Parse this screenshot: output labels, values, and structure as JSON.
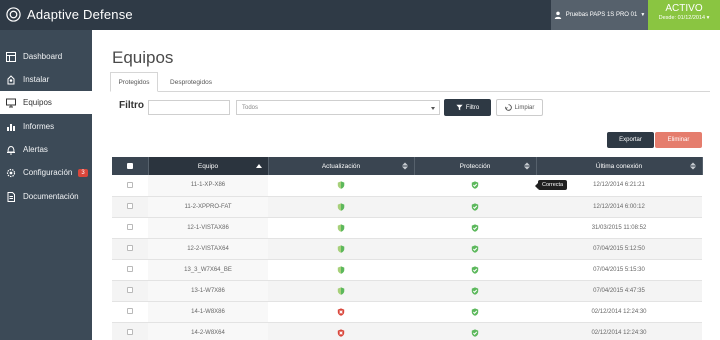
{
  "app": {
    "title": "Adaptive Defense"
  },
  "user": {
    "name": "Pruebas PAPS 1S PRO 01",
    "menu_icon": "user-icon"
  },
  "status": {
    "label": "ACTIVO",
    "since": "Desde: 01/12/2014"
  },
  "sidebar": {
    "items": [
      {
        "label": "Dashboard",
        "icon": "dashboard-icon"
      },
      {
        "label": "Instalar",
        "icon": "install-icon"
      },
      {
        "label": "Equipos",
        "icon": "monitor-icon",
        "active": true
      },
      {
        "label": "Informes",
        "icon": "reports-icon"
      },
      {
        "label": "Alertas",
        "icon": "bell-icon"
      },
      {
        "label": "Configuración",
        "icon": "gear-icon",
        "badge": "3"
      },
      {
        "label": "Documentación",
        "icon": "document-icon"
      }
    ]
  },
  "page": {
    "title": "Equipos"
  },
  "tabs": [
    {
      "label": "Protegidos",
      "active": true
    },
    {
      "label": "Desprotegidos"
    }
  ],
  "filter": {
    "label": "Filtro",
    "text_value": "",
    "select_value": "Todos",
    "filter_button": "Filtro",
    "clear_button": "Limpiar"
  },
  "actions": {
    "export": "Exportar",
    "delete": "Eliminar"
  },
  "table": {
    "headers": {
      "equipo": "Equipo",
      "actualizacion": "Actualización",
      "proteccion": "Protección",
      "ultima": "Última conexión"
    },
    "rows": [
      {
        "name": "11-1-XP-X86",
        "update": "ok",
        "protection": "ok",
        "last": "12/12/2014 6:21:21"
      },
      {
        "name": "11-2-XPPRO-FAT",
        "update": "ok",
        "protection": "ok",
        "last": "12/12/2014 6:00:12"
      },
      {
        "name": "12-1-VISTAX86",
        "update": "ok",
        "protection": "ok",
        "last": "31/03/2015 11:08:52"
      },
      {
        "name": "12-2-VISTAX64",
        "update": "ok",
        "protection": "ok",
        "last": "07/04/2015 5:12:50"
      },
      {
        "name": "13_3_W7X64_BE",
        "update": "ok",
        "protection": "ok",
        "last": "07/04/2015 5:15:30"
      },
      {
        "name": "13-1-W7X86",
        "update": "ok",
        "protection": "ok",
        "last": "07/04/2015 4:47:35"
      },
      {
        "name": "14-1-W8X86",
        "update": "error",
        "protection": "ok",
        "last": "02/12/2014 12:24:30"
      },
      {
        "name": "14-2-W8X64",
        "update": "error",
        "protection": "ok",
        "last": "02/12/2014 12:24:30"
      }
    ]
  },
  "tooltip": {
    "text": "Correcta"
  },
  "colors": {
    "topbar": "#2f3a46",
    "sidebar": "#3c4a57",
    "active_status": "#8ac541",
    "ok": "#5cb85c",
    "error": "#d9463b",
    "delete": "#e57d6d"
  }
}
